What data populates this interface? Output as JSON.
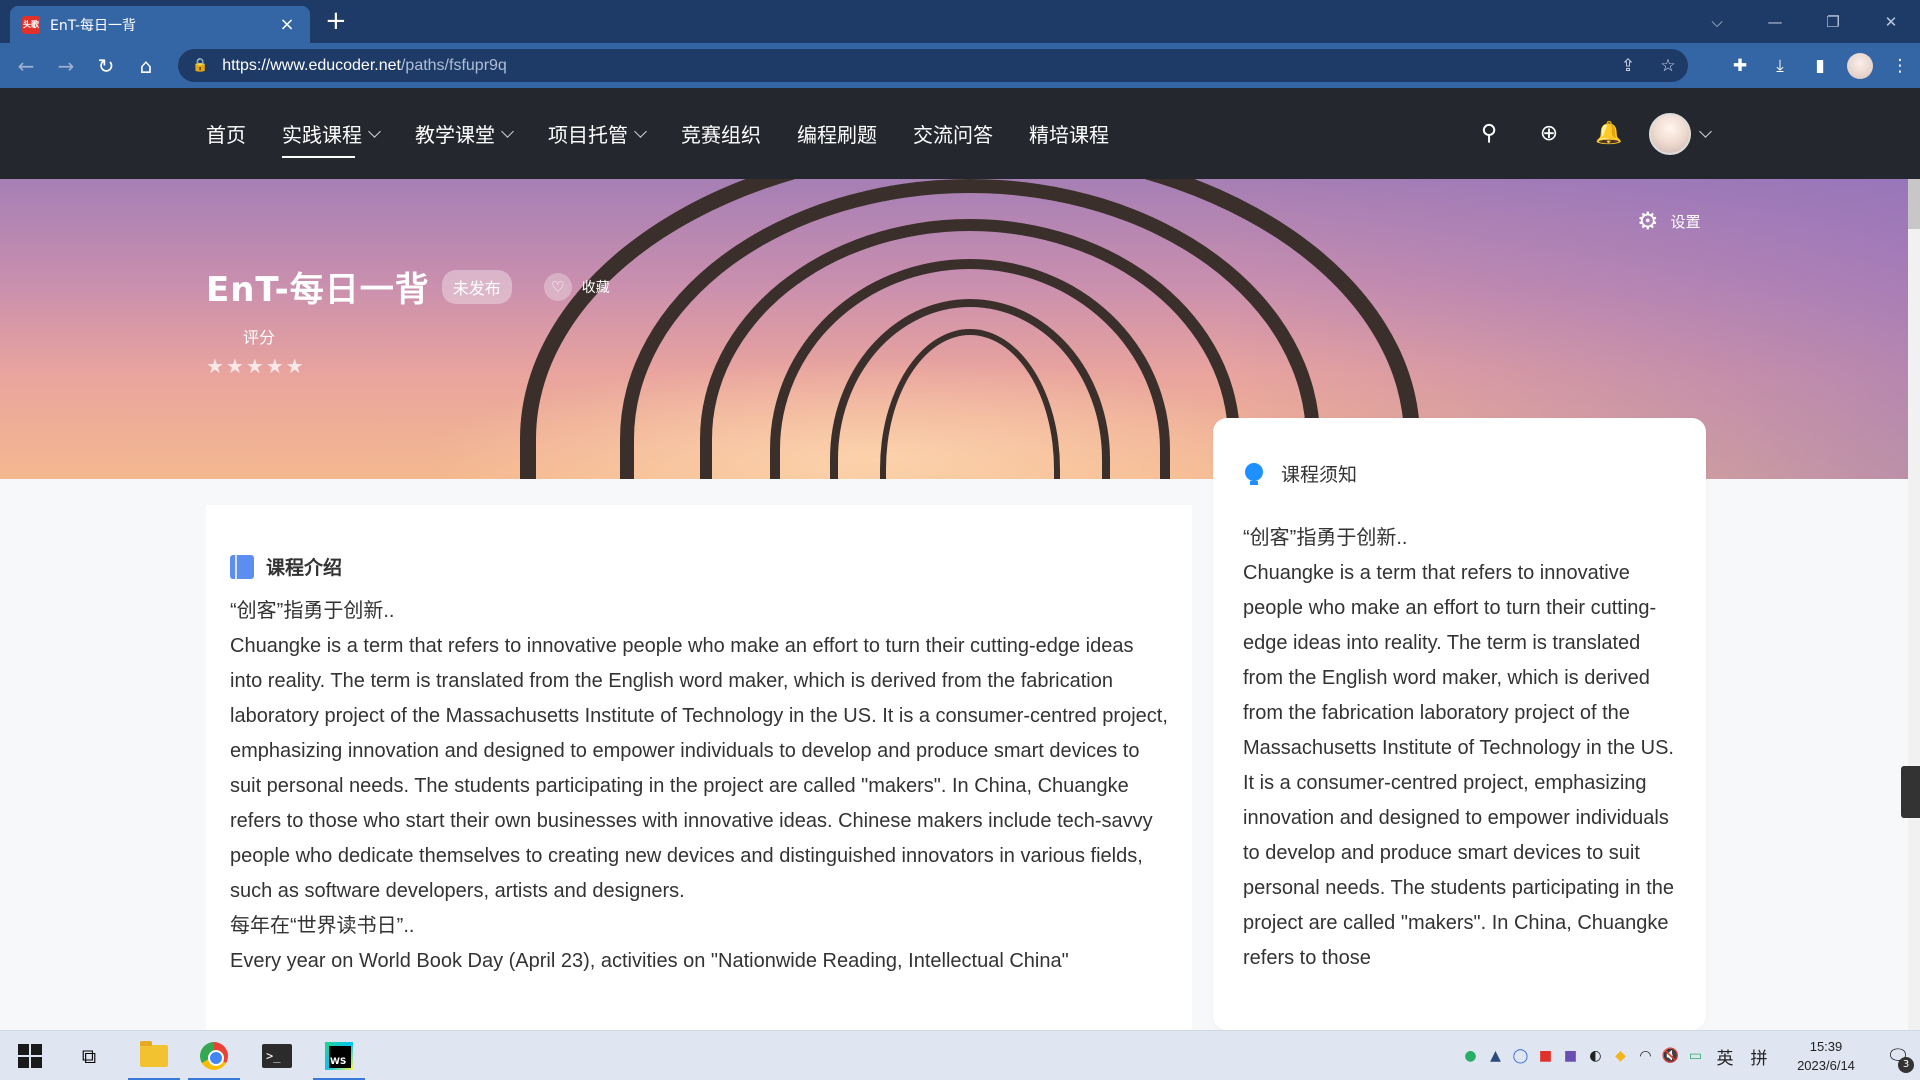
{
  "browser": {
    "tab_title": "EnT-每日一背",
    "favicon_text": "头歌",
    "url_domain": "https://www.educoder.net",
    "url_path": "/paths/fsfupr9q"
  },
  "site_nav": {
    "items": [
      "首页",
      "实践课程",
      "教学课堂",
      "项目托管",
      "竞赛组织",
      "编程刷题",
      "交流问答",
      "精培课程"
    ],
    "active": "实践课程"
  },
  "banner": {
    "title": "EnT-每日一背",
    "status_badge": "未发布",
    "favorite_label": "收藏",
    "rating_label": "评分",
    "rating_stars": 5,
    "settings_label": "设置"
  },
  "intro": {
    "heading": "课程介绍",
    "paragraphs": [
      "“创客”指勇于创新..",
      "Chuangke is a term that refers to innovative people who make an effort to turn their cutting-edge ideas into reality. The term is translated from the English word maker, which is derived from the fabrication laboratory project of the Massachusetts Institute of Technology in the US. It is a consumer-centred project, emphasizing innovation and designed to empower individuals to develop and produce smart devices to suit personal needs. The students participating in the project are called \"makers\". In China, Chuangke refers to those who start their own businesses with innovative ideas. Chinese makers include tech-savvy people who dedicate themselves to creating new devices and distinguished innovators in various fields, such as software developers, artists and designers.",
      "每年在“世界读书日”..",
      "Every year on World Book Day (April 23), activities on \"Nationwide Reading, Intellectual China\""
    ]
  },
  "notice": {
    "heading": "课程须知",
    "paragraphs": [
      "“创客”指勇于创新..",
      "Chuangke is a term that refers to innovative people who make an effort to turn their cutting-edge ideas into reality. The term is translated from the English word maker, which is derived from the fabrication laboratory project of the Massachusetts Institute of Technology in the US. It is a consumer-centred project, emphasizing innovation and designed to empower individuals to develop and produce smart devices to suit personal needs. The students participating in the project are called \"makers\". In China, Chuangke refers to those"
    ]
  },
  "taskbar": {
    "ime_lang": "英",
    "ime_mode": "拼",
    "time": "15:39",
    "date": "2023/6/14",
    "notification_count": "3"
  },
  "colors": {
    "tab_bar": "#1e3a66",
    "address_bar": "#3465a4",
    "site_header": "#24272e",
    "accent_blue": "#1e90ff"
  }
}
